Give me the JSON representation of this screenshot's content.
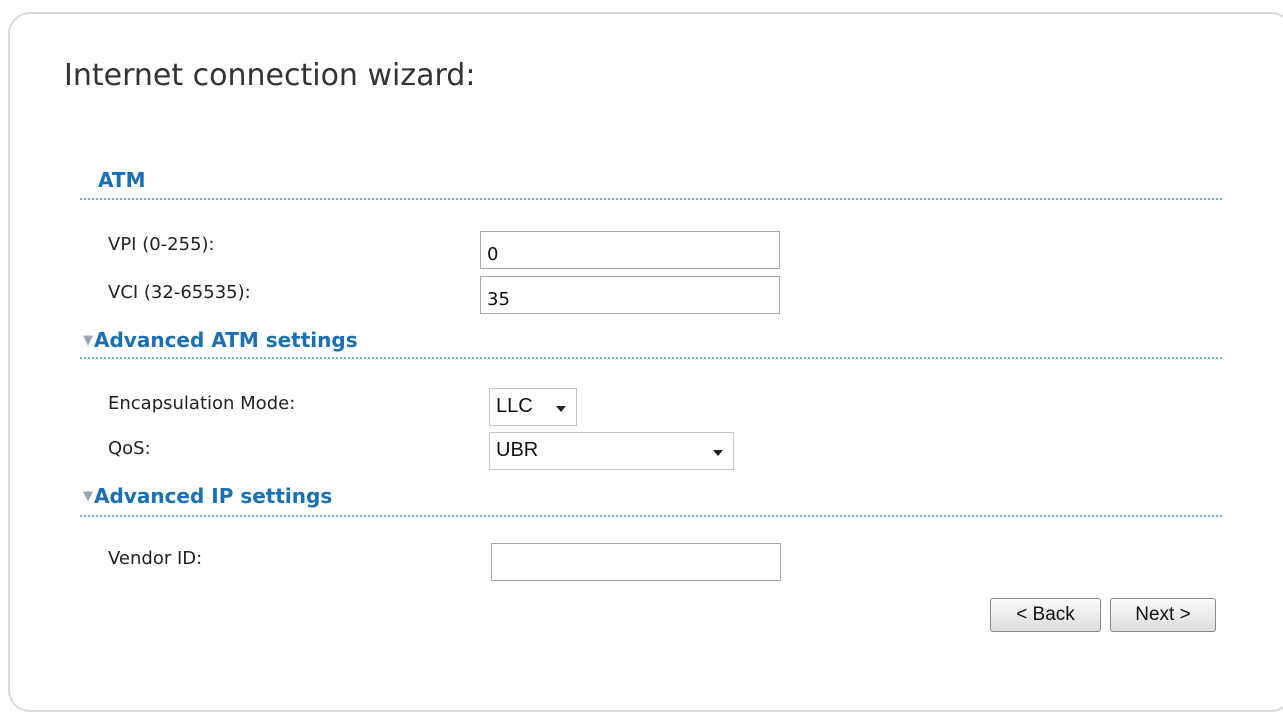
{
  "page_title": "Internet connection wizard:",
  "sections": {
    "atm": {
      "title": "ATM",
      "vpi": {
        "label": "VPI (0-255):",
        "value": "0"
      },
      "vci": {
        "label": "VCI (32-65535):",
        "value": "35"
      }
    },
    "advanced_atm": {
      "toggle_icon": "triangle-down-icon",
      "title": "Advanced ATM settings",
      "encapsulation": {
        "label": "Encapsulation Mode:",
        "selected": "LLC"
      },
      "qos": {
        "label": "QoS:",
        "selected": "UBR"
      }
    },
    "advanced_ip": {
      "toggle_icon": "triangle-down-icon",
      "title": "Advanced IP settings",
      "vendor_id": {
        "label": "Vendor ID:",
        "value": ""
      }
    }
  },
  "buttons": {
    "back": "< Back",
    "next": "Next >"
  },
  "colors": {
    "section_title": "#1a6fb5",
    "divider": "#5fb3d0"
  }
}
